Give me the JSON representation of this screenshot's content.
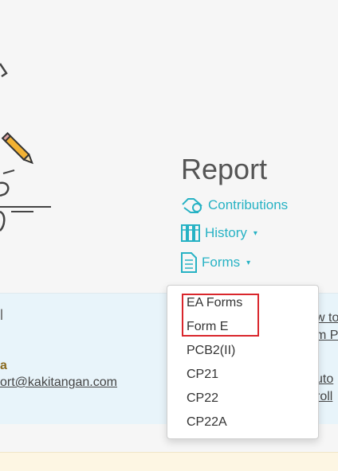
{
  "report": {
    "title": "Report",
    "links": [
      {
        "label": "Contributions",
        "icon": "hand-coins-icon"
      },
      {
        "label": "History",
        "icon": "binders-icon",
        "caret": "▾"
      },
      {
        "label": "Forms",
        "icon": "document-list-icon",
        "caret": "▾"
      }
    ]
  },
  "forms_dropdown": {
    "items": [
      "EA Forms",
      "Form E",
      "PCB2(II)",
      "CP21",
      "CP22",
      "CP22A"
    ],
    "highlighted": [
      "EA Forms",
      "Form E"
    ]
  },
  "info_band": {
    "pipe": "l",
    "name_fragment": "a",
    "email_fragment": "ort@kakitangan.com",
    "right_fragments": [
      "w to",
      "m P",
      "uto",
      "roll"
    ]
  },
  "colors": {
    "accent": "#27b2c4",
    "highlight_box": "#d9262c",
    "info_band_bg": "#e8f4fa",
    "name_text": "#8a6a1f"
  }
}
